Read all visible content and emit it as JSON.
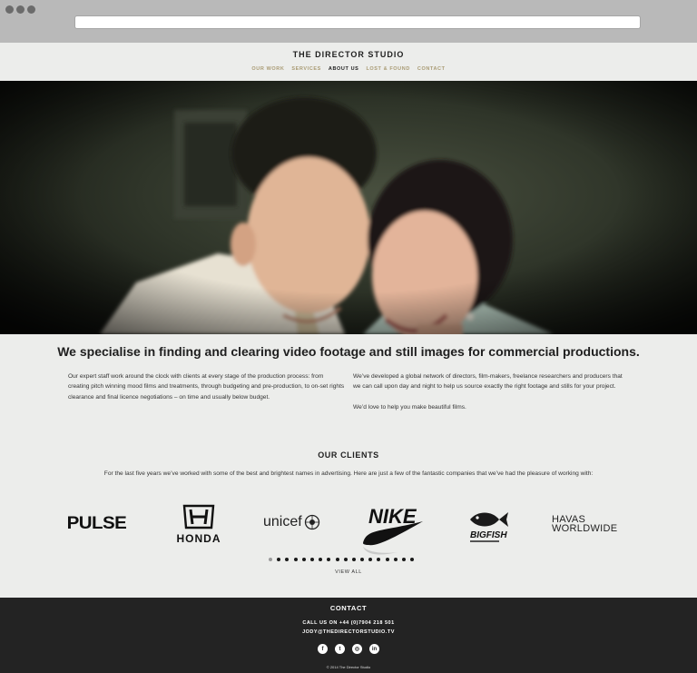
{
  "site": {
    "brand": "THE DIRECTOR STUDIO",
    "nav": [
      {
        "label": "OUR WORK",
        "active": false
      },
      {
        "label": "SERVICES",
        "active": false
      },
      {
        "label": "ABOUT US",
        "active": true
      },
      {
        "label": "LOST & FOUND",
        "active": false
      },
      {
        "label": "CONTACT",
        "active": false
      }
    ]
  },
  "intro": {
    "headline": "We specialise in finding and clearing video footage and still images for commercial productions.",
    "left_paragraph": "Our expert staff work around the clock with clients at every stage of the production process: from creating pitch winning mood films and treatments, through budgeting and pre-production, to on-set rights clearance and final licence negotiations – on time and usually below budget.",
    "right_paragraph_1": "We’ve developed a global network of directors, film-makers, freelance researchers and producers that we can call upon day and night to help us source exactly the right footage and stills for your project.",
    "right_paragraph_2": "We’d love to help you make beautiful films."
  },
  "clients": {
    "title": "OUR CLIENTS",
    "description": "For the last five years we’ve worked with some of the best and brightest names in advertising. Here are just a few of the fantastic companies that we’ve had the pleasure of working with:",
    "logos": {
      "pulse": "PULSE",
      "honda": "HONDA",
      "unicef": "unicef",
      "nike": "NIKE",
      "bigfish": "BIGFISH",
      "havas_line1": "HAVAS",
      "havas_line2": "WORLDWIDE"
    },
    "pager_count": 18,
    "pager_active_index": 0,
    "view_all": "VIEW ALL"
  },
  "footer": {
    "title": "CONTACT",
    "phone": "CALL US ON +44 (0)7904 218 501",
    "email": "JODY@THEDIRECTORSTUDIO.TV",
    "socials": [
      {
        "icon": "facebook-icon",
        "glyph": "f"
      },
      {
        "icon": "twitter-icon",
        "glyph": "t"
      },
      {
        "icon": "instagram-icon",
        "glyph": "◎"
      },
      {
        "icon": "linkedin-icon",
        "glyph": "in"
      }
    ],
    "copyright": "© 2014 The Director Studio"
  }
}
